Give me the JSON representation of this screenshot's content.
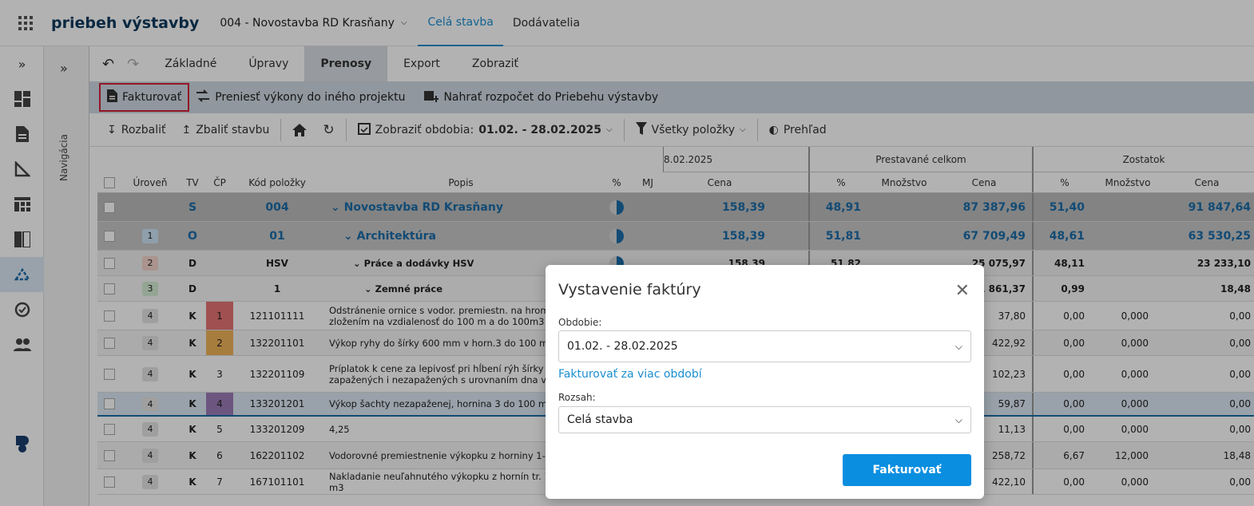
{
  "app": {
    "title": "priebeh výstavby",
    "project": "004 - Novostavba RD Krasňany",
    "tabs": [
      "Celá stavba",
      "Dodávatelia"
    ],
    "active_tab": "Celá stavba"
  },
  "nav": {
    "label": "Navigácia"
  },
  "ribbon": {
    "tabs": [
      "Základné",
      "Úpravy",
      "Prenosy",
      "Export",
      "Zobraziť"
    ],
    "active": "Prenosy"
  },
  "actions": {
    "invoice": "Fakturovať",
    "transfer": "Preniesť výkony do iného projektu",
    "upload": "Nahrať rozpočet do Priebehu výstavby"
  },
  "toolbar": {
    "expand": "Rozbaliť",
    "collapse": "Zbaliť stavbu",
    "period_prefix": "Zobraziť obdobia:",
    "period_value": "01.02. - 28.02.2025",
    "filter": "Všetky položky",
    "overview": "Prehľad"
  },
  "table": {
    "group_headers": [
      "8.02.2025",
      "Prestavané celkom",
      "Zostatok"
    ],
    "headers": [
      "Úroveň",
      "TV",
      "ČP",
      "Kód položky",
      "Popis",
      "%",
      "MJ",
      "Cena",
      "%",
      "Množstvo",
      "Cena",
      "%",
      "Množstvo",
      "Cena"
    ],
    "rows": [
      {
        "lvl": "",
        "tv": "S",
        "cp": "",
        "code": "004",
        "desc": "Novostavba RD Krasňany",
        "price": "158,39",
        "p_pct": "48,91",
        "p_qty": "",
        "p_price": "87 387,96",
        "z_pct": "51,40",
        "z_qty": "",
        "z_price": "91 847,64"
      },
      {
        "lvl": "1",
        "tv": "O",
        "cp": "",
        "code": "01",
        "desc": "Architektúra",
        "price": "158,39",
        "p_pct": "51,81",
        "p_qty": "",
        "p_price": "67 709,49",
        "z_pct": "48,61",
        "z_qty": "",
        "z_price": "63 530,25"
      },
      {
        "lvl": "2",
        "tv": "D",
        "cp": "",
        "code": "HSV",
        "desc": "Práce a dodávky HSV",
        "price": "158,39",
        "p_pct": "51,82",
        "p_qty": "",
        "p_price": "25 075,97",
        "z_pct": "48,11",
        "z_qty": "",
        "z_price": "23 233,10"
      },
      {
        "lvl": "3",
        "tv": "D",
        "cp": "",
        "code": "1",
        "desc": "Zemné práce",
        "price": "",
        "p_pct": "",
        "p_qty": "",
        "p_price": "1 861,37",
        "z_pct": "0,99",
        "z_qty": "",
        "z_price": "18,48"
      },
      {
        "lvl": "4",
        "tv": "K",
        "cp": "1",
        "code": "121101111",
        "desc": "Odstránenie ornice s vodor. premiestn. na hromady so zložením na vzdialenosť do 100 m a do 100m3",
        "price": "",
        "p_pct": "",
        "p_qty": "",
        "p_price": "37,80",
        "z_pct": "0,00",
        "z_qty": "0,000",
        "z_price": "0,00"
      },
      {
        "lvl": "4",
        "tv": "K",
        "cp": "2",
        "code": "132201101",
        "desc": "Výkop ryhy do šírky 600 mm v horn.3 do 100 m3",
        "price": "",
        "p_pct": "",
        "p_qty": "",
        "p_price": "422,92",
        "z_pct": "0,00",
        "z_qty": "0,000",
        "z_price": "0,00"
      },
      {
        "lvl": "4",
        "tv": "K",
        "cp": "3",
        "code": "132201109",
        "desc": "Príplatok k cene za lepivosť pri hĺbení rýh šírky do 600 mm zapažených i nezapažených s urovnaním dna v hornine 3",
        "price": "",
        "p_pct": "",
        "p_qty": "",
        "p_price": "102,23",
        "z_pct": "0,00",
        "z_qty": "0,000",
        "z_price": "0,00"
      },
      {
        "lvl": "4",
        "tv": "K",
        "cp": "4",
        "code": "133201201",
        "desc": "Výkop šachty nezapaženej, hornina 3 do 100 m3",
        "price": "",
        "p_pct": "",
        "p_qty": "",
        "p_price": "59,87",
        "z_pct": "0,00",
        "z_qty": "0,000",
        "z_price": "0,00"
      },
      {
        "lvl": "4",
        "tv": "K",
        "cp": "5",
        "code": "133201209",
        "desc": "4,25",
        "price": "",
        "p_pct": "",
        "p_qty": "",
        "p_price": "11,13",
        "z_pct": "0,00",
        "z_qty": "0,000",
        "z_price": "0,00"
      },
      {
        "lvl": "4",
        "tv": "K",
        "cp": "6",
        "code": "162201102",
        "desc": "Vodorovné premiestnenie výkopku z horniny 1-4 do 50m",
        "price": "",
        "p_pct": "",
        "p_qty": "",
        "p_price": "258,72",
        "z_pct": "6,67",
        "z_qty": "12,000",
        "z_price": "18,48"
      },
      {
        "lvl": "4",
        "tv": "K",
        "cp": "7",
        "code": "167101101",
        "desc": "Nakladanie neuľahnutého výkopku z hornín tr. 1-4 do 100 m3",
        "price": "",
        "p_pct": "",
        "p_qty": "",
        "p_price": "422,10",
        "z_pct": "0,00",
        "z_qty": "0,000",
        "z_price": "0,00"
      }
    ]
  },
  "modal": {
    "title": "Vystavenie faktúry",
    "period_label": "Obdobie:",
    "period_value": "01.02. - 28.02.2025",
    "multi_link": "Fakturovať za viac období",
    "scope_label": "Rozsah:",
    "scope_value": "Celá stavba",
    "submit": "Fakturovať"
  },
  "colors": {
    "accent": "#0a8ee0",
    "highlight": "#d02038",
    "cp1": "#e57373",
    "cp2": "#f0b45a",
    "cp4": "#9b7bb8"
  }
}
